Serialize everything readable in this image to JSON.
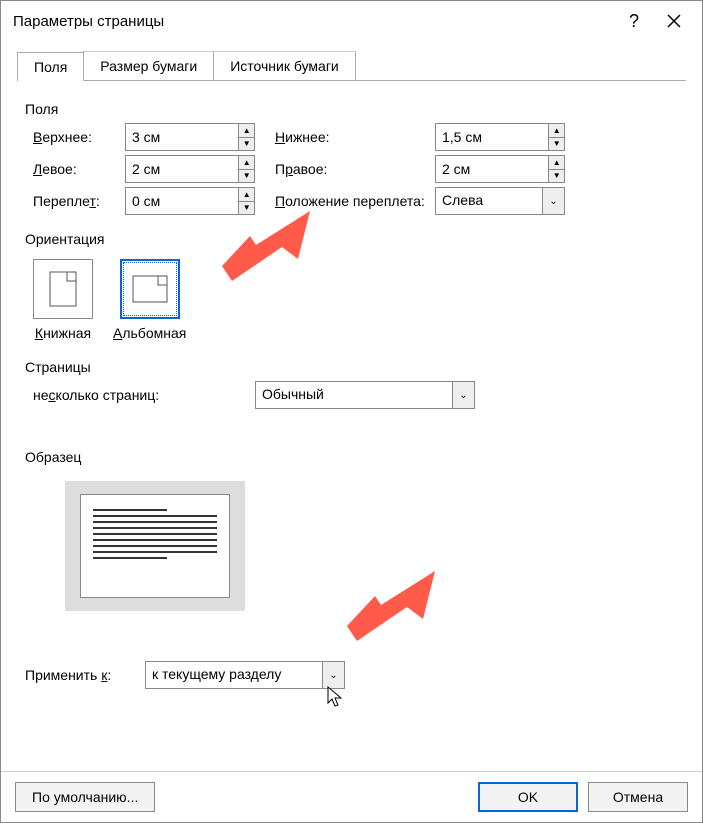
{
  "title": "Параметры страницы",
  "tabs": {
    "t0": "Поля",
    "t1": "Размер бумаги",
    "t2": "Источник бумаги"
  },
  "margins": {
    "group": "Поля",
    "top_l": "Верхнее:",
    "top_v": "3 см",
    "bottom_l": "Нижнее:",
    "bottom_v": "1,5 см",
    "left_l": "Левое:",
    "left_v": "2 см",
    "right_l": "Правое:",
    "right_v": "2 см",
    "gutter_l": "Переплет:",
    "gutter_v": "0 см",
    "gutpos_l": "Положение переплета:",
    "gutpos_v": "Слева"
  },
  "orient": {
    "group": "Ориентация",
    "portrait": "Книжная",
    "landscape": "Альбомная"
  },
  "pages": {
    "group": "Страницы",
    "multi_l": "несколько страниц:",
    "multi_v": "Обычный"
  },
  "preview": {
    "group": "Образец"
  },
  "apply": {
    "label": "Применить к:",
    "value": "к текущему разделу"
  },
  "footer": {
    "default": "По умолчанию...",
    "ok": "OK",
    "cancel": "Отмена"
  }
}
